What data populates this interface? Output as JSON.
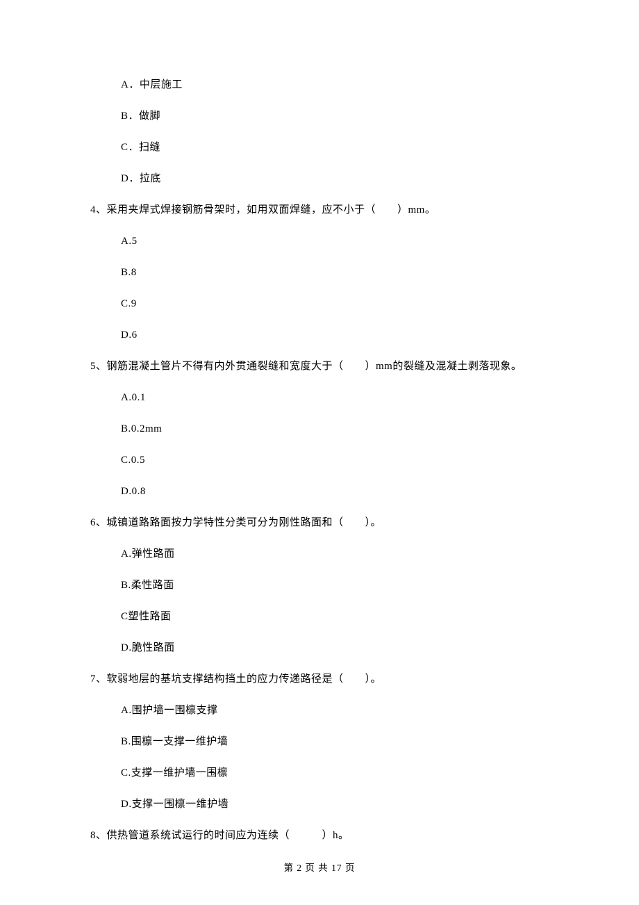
{
  "options_q3": {
    "a": "A．中层施工",
    "b": "B．做脚",
    "c": "C．扫缝",
    "d": "D．拉底"
  },
  "q4": {
    "text": "4、采用夹焊式焊接钢筋骨架时，如用双面焊缝，应不小于（　　）mm。",
    "a": "A.5",
    "b": "B.8",
    "c": "C.9",
    "d": "D.6"
  },
  "q5": {
    "text": "5、钢筋混凝土管片不得有内外贯通裂缝和宽度大于（　　）mm的裂缝及混凝土剥落现象。",
    "a": "A.0.1",
    "b": "B.0.2mm",
    "c": "C.0.5",
    "d": "D.0.8"
  },
  "q6": {
    "text": "6、城镇道路路面按力学特性分类可分为刚性路面和（　　）。",
    "a": "A.弹性路面",
    "b": "B.柔性路面",
    "c": "C塑性路面",
    "d": "D.脆性路面"
  },
  "q7": {
    "text": "7、软弱地层的基坑支撑结构挡土的应力传递路径是（　　）。",
    "a": "A.围护墙一围檩支撑",
    "b": "B.围檩一支撑一维护墙",
    "c": "C.支撑一维护墙一围檩",
    "d": "D.支撑一围檩一维护墙"
  },
  "q8": {
    "text": "8、供热管道系统试运行的时间应为连续（　　　）h。"
  },
  "footer": "第 2 页 共 17 页"
}
